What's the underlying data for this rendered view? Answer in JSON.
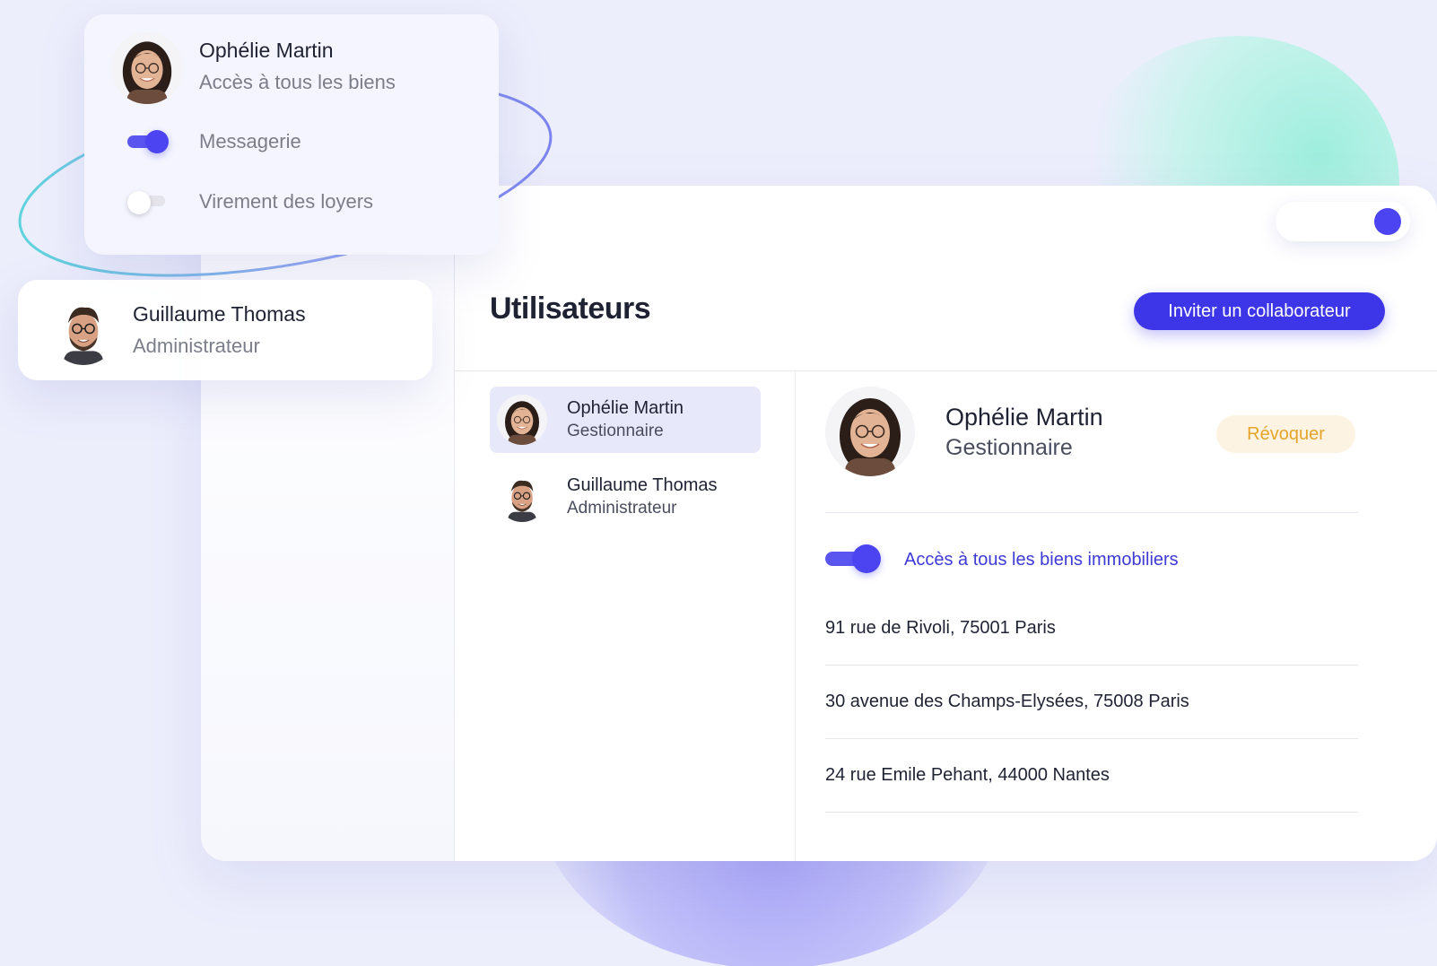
{
  "app": {
    "title": "Utilisateurs",
    "invite_button": "Inviter un collaborateur"
  },
  "users": [
    {
      "name": "Ophélie Martin",
      "role": "Gestionnaire",
      "selected": true
    },
    {
      "name": "Guillaume Thomas",
      "role": "Administrateur",
      "selected": false
    }
  ],
  "detail": {
    "name": "Ophélie Martin",
    "role": "Gestionnaire",
    "revoke_button": "Révoquer",
    "access_toggle": {
      "label": "Accès à tous les biens immobiliers",
      "on": true
    },
    "addresses": [
      "91 rue de Rivoli, 75001 Paris",
      "30 avenue des Champs-Elysées, 75008 Paris",
      "24 rue Emile Pehant, 44000 Nantes"
    ]
  },
  "floating_card_ophelie": {
    "name": "Ophélie Martin",
    "subtitle": "Accès à tous les biens",
    "options": [
      {
        "label": "Messagerie",
        "on": true
      },
      {
        "label": "Virement des loyers",
        "on": false
      }
    ]
  },
  "floating_card_guillaume": {
    "name": "Guillaume Thomas",
    "subtitle": "Administrateur"
  },
  "top_toggle": {
    "on": true
  },
  "colors": {
    "accent": "#3d35e8",
    "revoke_bg": "#fdf3e3",
    "revoke_text": "#e4a52a",
    "background": "#eceefc"
  },
  "icons": {
    "woman_avatar": "avatar-woman-glasses",
    "man_avatar": "avatar-man-glasses"
  }
}
